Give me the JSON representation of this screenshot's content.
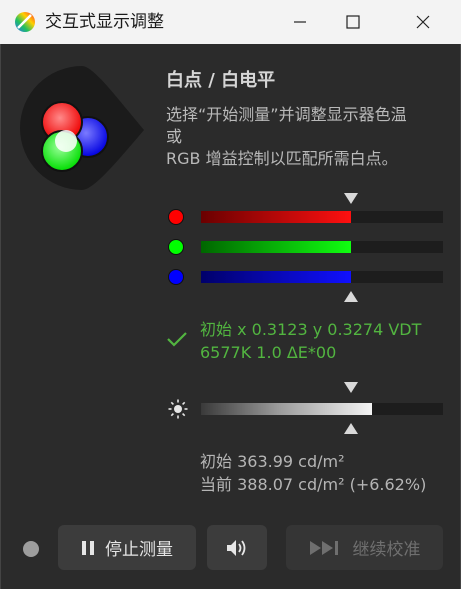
{
  "window": {
    "title": "交互式显示调整",
    "controls": {
      "minimize": "minimize-icon",
      "maximize": "maximize-icon",
      "close": "close-icon"
    }
  },
  "header": {
    "title": "白点 / 白电平",
    "description_lines": [
      "选择“开始测量”并调整显示器色温",
      "或",
      "RGB 增益控制以匹配所需白点。"
    ]
  },
  "rgb_gains": {
    "target_marker": 0.62,
    "channels": [
      {
        "name": "red",
        "color": "#ff0000",
        "level": 0.62
      },
      {
        "name": "green",
        "color": "#00ff00",
        "level": 0.62
      },
      {
        "name": "blue",
        "color": "#0000ff",
        "level": 0.62
      }
    ]
  },
  "status": {
    "icon": "checkmark-icon",
    "color": "#52b540",
    "line1": "初始 x 0.3123 y 0.3274 VDT",
    "line2": "6577K 1.0 ΔE*00"
  },
  "luminance": {
    "icon": "brightness-icon",
    "level": 0.705,
    "target_marker": 0.62,
    "initial": "初始 363.99 cd/m²",
    "current": "当前 388.07 cd/m² (+6.62%)"
  },
  "footer": {
    "indicator_color": "#9d9d9d",
    "stop_button": {
      "icon": "pause-icon",
      "label": "停止测量"
    },
    "sound_button": {
      "icon": "speaker-icon"
    },
    "continue_button": {
      "icon": "skip-forward-icon",
      "label": "继续校准",
      "disabled": true
    }
  },
  "colors": {
    "background": "#2b2b2b",
    "titlebar": "#f3f3f3",
    "accent_green": "#52b540"
  }
}
